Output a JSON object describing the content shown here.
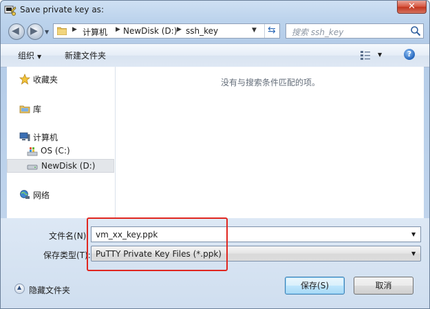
{
  "window": {
    "title": "Save private key as:",
    "close_symbol": "✕"
  },
  "address": {
    "crumbs": [
      "计算机",
      "NewDisk (D:)",
      "ssh_key"
    ],
    "search_placeholder": "搜索 ssh_key"
  },
  "toolbar": {
    "organize_label": "组织",
    "new_folder_label": "新建文件夹",
    "help_symbol": "?"
  },
  "nav": {
    "favorites": "收藏夹",
    "libraries": "库",
    "computer": "计算机",
    "drive_c": "OS (C:)",
    "drive_d": "NewDisk (D:)",
    "network": "网络",
    "selected": "NewDisk (D:)"
  },
  "content": {
    "empty_message": "没有与搜索条件匹配的项。"
  },
  "form": {
    "filename_label": "文件名",
    "filename_hotkey": "(N):",
    "filename_value": "vm_xx_key.ppk",
    "filetype_label": "保存类型",
    "filetype_hotkey": "(T):",
    "filetype_value": "PuTTY Private Key Files (*.ppk)"
  },
  "footer": {
    "hide_folders_label": "隐藏文件夹",
    "save_label": "保存",
    "save_hotkey": "(S)",
    "cancel_label": "取消"
  },
  "colors": {
    "highlight_border": "#e0261f",
    "accent": "#2f6bb8"
  }
}
